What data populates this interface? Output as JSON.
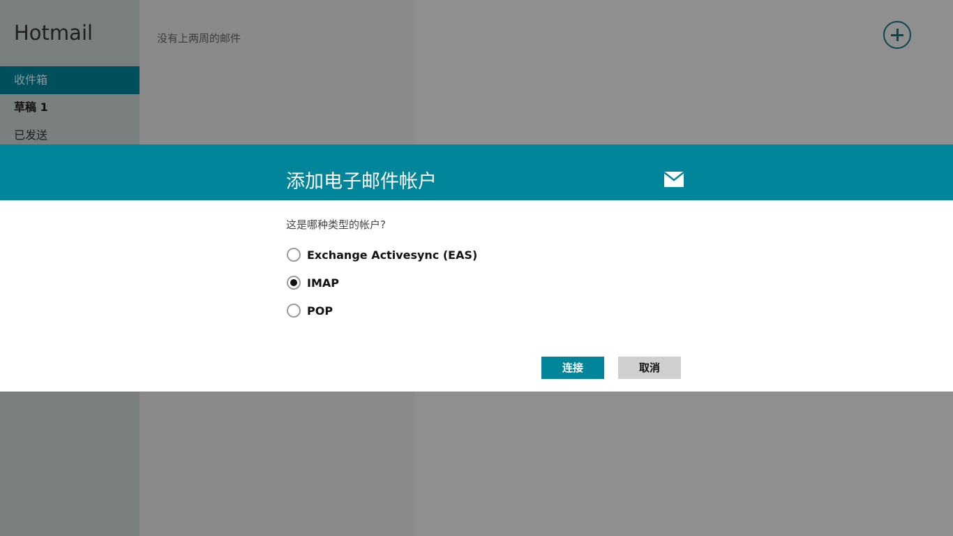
{
  "app": {
    "title": "Hotmail",
    "folders": [
      {
        "label": "收件箱"
      },
      {
        "label": "草稿  1"
      },
      {
        "label": "已发送"
      }
    ],
    "empty_message": "没有上两周的邮件"
  },
  "dialog": {
    "title": "添加电子邮件帐户",
    "question": "这是哪种类型的帐户?",
    "options": [
      {
        "label": "Exchange Activesync (EAS)",
        "selected": false
      },
      {
        "label": "IMAP",
        "selected": true
      },
      {
        "label": "POP",
        "selected": false
      }
    ],
    "connect_label": "连接",
    "cancel_label": "取消"
  },
  "colors": {
    "accent": "#00859b",
    "selected_folder": "#004f5c"
  },
  "icons": {
    "add": "plus-circle-icon",
    "mail": "envelope-icon"
  }
}
